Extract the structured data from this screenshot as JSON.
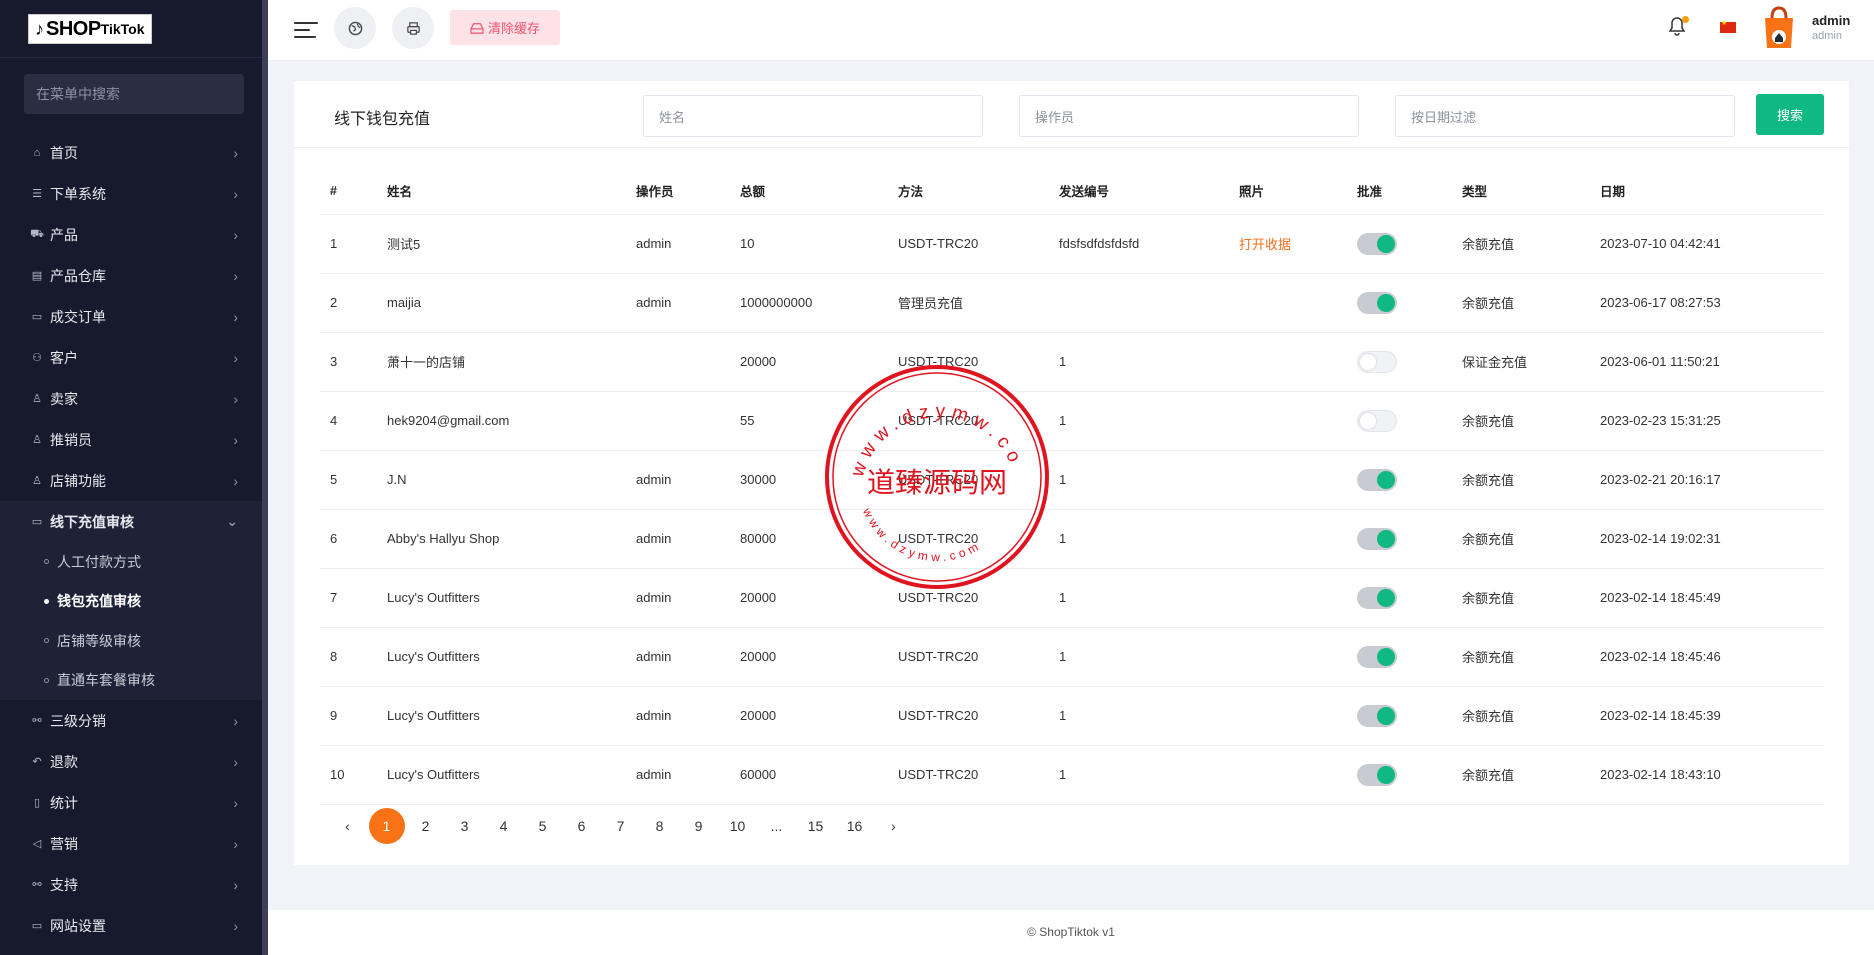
{
  "brand": {
    "logo_text": "SHOP",
    "logo_suffix": "TikTok",
    "logo_glyph": "d"
  },
  "sidebar": {
    "search_placeholder": "在菜单中搜索",
    "items": [
      {
        "label": "首页",
        "icon": "home-icon"
      },
      {
        "label": "下单系统",
        "icon": "list-icon"
      },
      {
        "label": "产品",
        "icon": "cart-icon"
      },
      {
        "label": "产品仓库",
        "icon": "warehouse-icon"
      },
      {
        "label": "成交订单",
        "icon": "order-icon"
      },
      {
        "label": "客户",
        "icon": "users-icon"
      },
      {
        "label": "卖家",
        "icon": "user-icon"
      },
      {
        "label": "推销员",
        "icon": "user-icon"
      },
      {
        "label": "店铺功能",
        "icon": "user-icon"
      },
      {
        "label": "线下充值审核",
        "icon": "card-icon"
      }
    ],
    "sub_items": [
      {
        "label": "人工付款方式"
      },
      {
        "label": "钱包充值审核"
      },
      {
        "label": "店铺等级审核"
      },
      {
        "label": "直通车套餐审核"
      }
    ],
    "items_after": [
      {
        "label": "三级分销",
        "icon": "link-icon"
      },
      {
        "label": "退款",
        "icon": "refund-icon"
      },
      {
        "label": "统计",
        "icon": "file-icon"
      },
      {
        "label": "营销",
        "icon": "megaphone-icon"
      },
      {
        "label": "支持",
        "icon": "link-icon"
      },
      {
        "label": "网站设置",
        "icon": "monitor-icon"
      }
    ]
  },
  "topbar": {
    "clear_cache_label": "清除缓存",
    "user_name": "admin",
    "user_role": "admin"
  },
  "page": {
    "title": "线下钱包充值",
    "filter_name_placeholder": "姓名",
    "filter_operator_placeholder": "操作员",
    "filter_date_placeholder": "按日期过滤",
    "search_label": "搜索"
  },
  "table": {
    "headers": [
      "#",
      "姓名",
      "操作员",
      "总额",
      "方法",
      "发送编号",
      "照片",
      "批准",
      "类型",
      "日期"
    ],
    "rows": [
      {
        "n": "1",
        "name": "测试5",
        "operator": "admin",
        "amount": "10",
        "method": "USDT-TRC20",
        "send_no": "fdsfsdfdsfdsfd",
        "photo": "打开收据",
        "approved": true,
        "type": "余额充值",
        "date": "2023-07-10 04:42:41"
      },
      {
        "n": "2",
        "name": "maijia",
        "operator": "admin",
        "amount": "1000000000",
        "method": "管理员充值",
        "send_no": "",
        "photo": "",
        "approved": true,
        "type": "余额充值",
        "date": "2023-06-17 08:27:53"
      },
      {
        "n": "3",
        "name": "萧十一的店铺",
        "operator": "",
        "amount": "20000",
        "method": "USDT-TRC20",
        "send_no": "1",
        "photo": "",
        "approved": false,
        "type": "保证金充值",
        "date": "2023-06-01 11:50:21"
      },
      {
        "n": "4",
        "name": "hek9204@gmail.com",
        "operator": "",
        "amount": "55",
        "method": "USDT-TRC20",
        "send_no": "1",
        "photo": "",
        "approved": false,
        "type": "余额充值",
        "date": "2023-02-23 15:31:25"
      },
      {
        "n": "5",
        "name": "J.N",
        "operator": "admin",
        "amount": "30000",
        "method": "USDT-TRC20",
        "send_no": "1",
        "photo": "",
        "approved": true,
        "type": "余额充值",
        "date": "2023-02-21 20:16:17"
      },
      {
        "n": "6",
        "name": "Abby's Hallyu Shop",
        "operator": "admin",
        "amount": "80000",
        "method": "USDT-TRC20",
        "send_no": "1",
        "photo": "",
        "approved": true,
        "type": "余额充值",
        "date": "2023-02-14 19:02:31"
      },
      {
        "n": "7",
        "name": "Lucy's Outfitters",
        "operator": "admin",
        "amount": "20000",
        "method": "USDT-TRC20",
        "send_no": "1",
        "photo": "",
        "approved": true,
        "type": "余额充值",
        "date": "2023-02-14 18:45:49"
      },
      {
        "n": "8",
        "name": "Lucy's Outfitters",
        "operator": "admin",
        "amount": "20000",
        "method": "USDT-TRC20",
        "send_no": "1",
        "photo": "",
        "approved": true,
        "type": "余额充值",
        "date": "2023-02-14 18:45:46"
      },
      {
        "n": "9",
        "name": "Lucy's Outfitters",
        "operator": "admin",
        "amount": "20000",
        "method": "USDT-TRC20",
        "send_no": "1",
        "photo": "",
        "approved": true,
        "type": "余额充值",
        "date": "2023-02-14 18:45:39"
      },
      {
        "n": "10",
        "name": "Lucy's Outfitters",
        "operator": "admin",
        "amount": "60000",
        "method": "USDT-TRC20",
        "send_no": "1",
        "photo": "",
        "approved": true,
        "type": "余额充值",
        "date": "2023-02-14 18:43:10"
      }
    ]
  },
  "pagination": {
    "prev": "‹",
    "pages": [
      "1",
      "2",
      "3",
      "4",
      "5",
      "6",
      "7",
      "8",
      "9",
      "10",
      "...",
      "15",
      "16"
    ],
    "current": "1",
    "next": "›"
  },
  "footer": {
    "text": "© ShopTiktok v1"
  },
  "watermark": {
    "center_text": "道臻源码网",
    "ring_top": "www.dzymw.com",
    "ring_bottom": "www.dzymw.com"
  },
  "colors": {
    "accent_green": "#10b981",
    "accent_orange": "#f97316",
    "sidebar_bg": "#171a2d",
    "danger_pink": "#f0536f"
  }
}
